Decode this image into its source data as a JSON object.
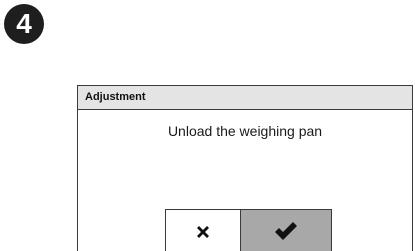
{
  "step": {
    "number": "4"
  },
  "dialog": {
    "title": "Adjustment",
    "message": "Unload the weighing pan",
    "cancel_icon": "cross-icon",
    "confirm_icon": "checkmark-icon"
  },
  "colors": {
    "badge_bg": "#1e1e1e",
    "header_bg": "#e4e4e4",
    "confirm_bg": "#a8a8a8"
  }
}
